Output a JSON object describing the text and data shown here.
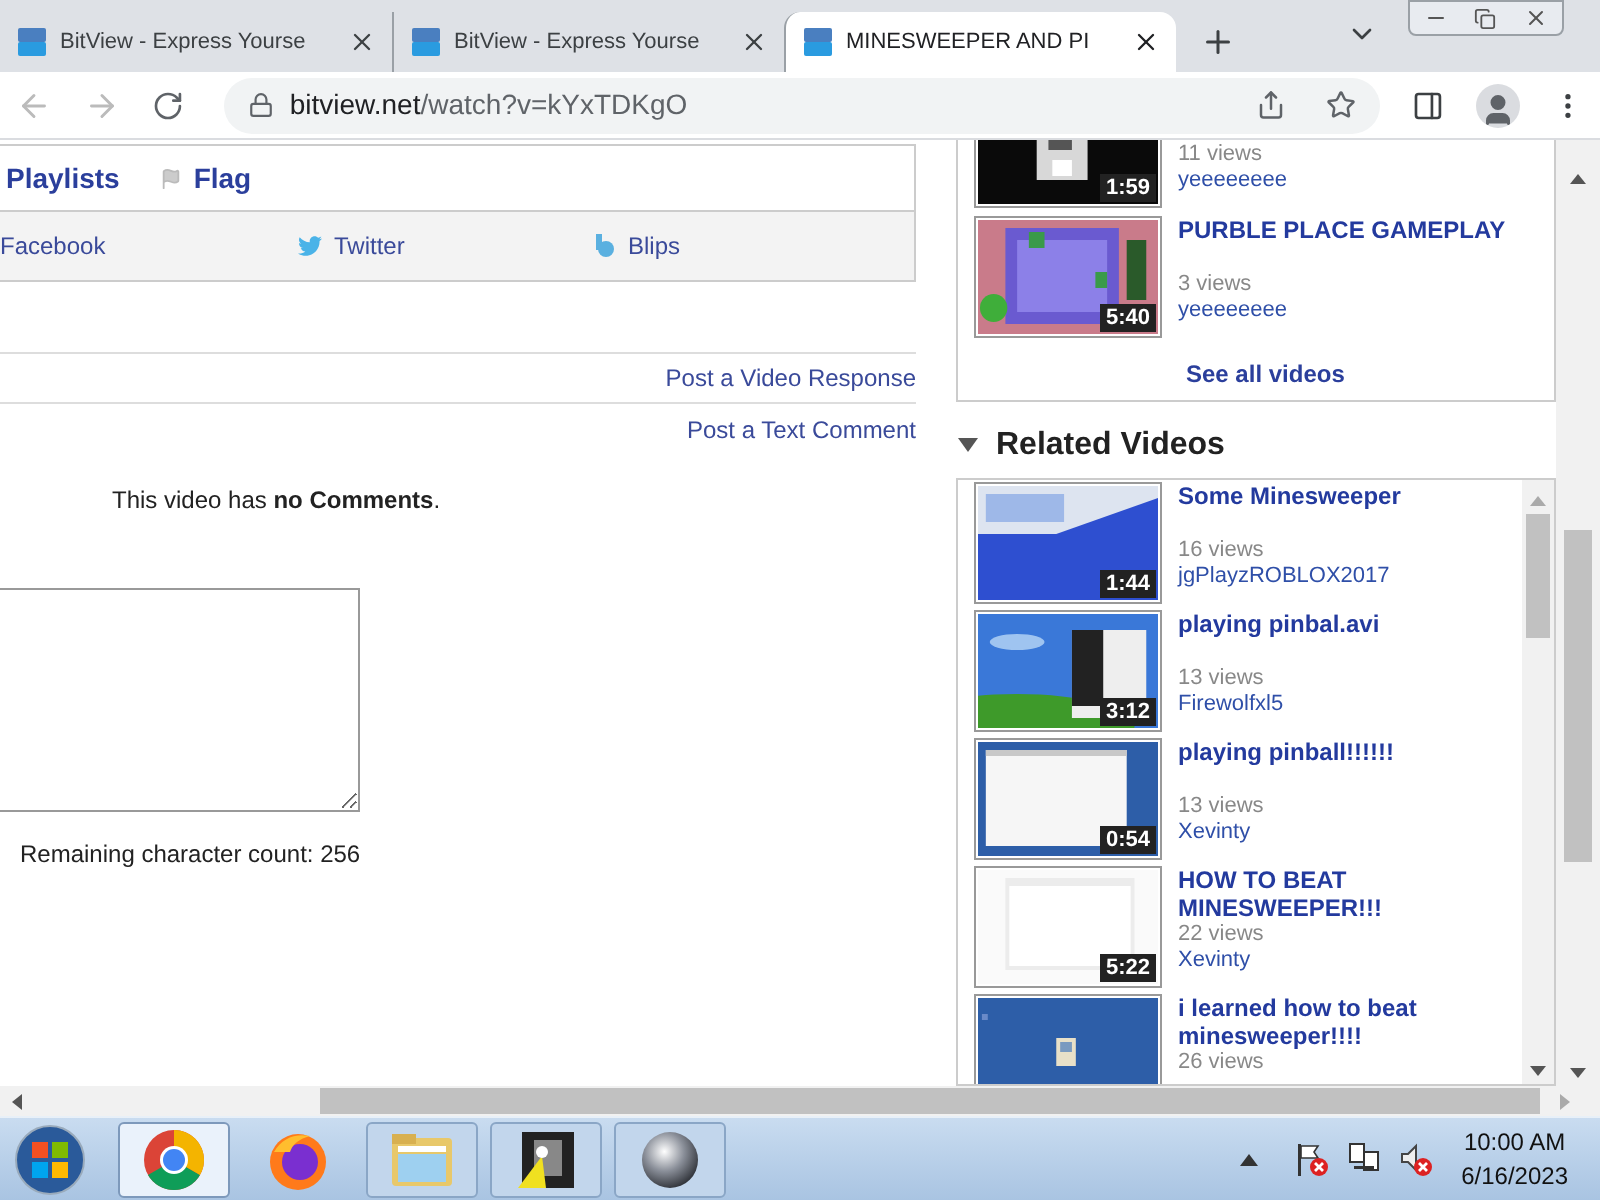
{
  "browser": {
    "tabs": [
      {
        "title": "BitView - Express Yourse",
        "selected": false
      },
      {
        "title": "BitView - Express Yourse",
        "selected": false
      },
      {
        "title": "MINESWEEPER AND PI",
        "selected": true
      }
    ],
    "address": {
      "host": "bitview.net",
      "path": "/watch?v=kYxTDKgO"
    }
  },
  "actions": {
    "links": [
      {
        "kind": "playlists",
        "label": "Playlists"
      },
      {
        "kind": "flag",
        "label": "Flag"
      }
    ],
    "share": [
      {
        "kind": "facebook",
        "label": "Facebook"
      },
      {
        "kind": "twitter",
        "label": "Twitter"
      },
      {
        "kind": "blips",
        "label": "Blips"
      }
    ]
  },
  "comments": {
    "post_links": [
      "Post a Video Response",
      "Post a Text Comment"
    ],
    "empty_message": "This video has **no Comments**.",
    "counter": "Remaining character count: 256"
  },
  "more_videos": {
    "items": [
      {
        "views": "11 views",
        "author": "yeeeeeeee",
        "duration": "1:59"
      },
      {
        "title": "PURBLE PLACE GAMEPLAY",
        "views": "3 views",
        "author": "yeeeeeeee",
        "duration": "5:40"
      }
    ],
    "see_all": "See all videos"
  },
  "related": {
    "heading": "Related Videos",
    "expanded": true,
    "items": [
      {
        "title": "Some Minesweeper",
        "views": "16 views",
        "author": "jgPlayzROBLOX2017",
        "duration": "1:44"
      },
      {
        "title": "playing pinbal.avi",
        "views": "13 views",
        "author": "Firewolfxl5",
        "duration": "3:12"
      },
      {
        "title": "playing pinball!!!!!!",
        "views": "13 views",
        "author": "Xevinty",
        "duration": "0:54"
      },
      {
        "title": "HOW TO BEAT MINESWEEPER!!!",
        "views": "22 views",
        "author": "Xevinty",
        "duration": "5:22"
      },
      {
        "title": "i learned how to beat minesweeper!!!!",
        "views": "26 views"
      }
    ]
  },
  "taskbar": {
    "apps": [
      {
        "kind": "chrome",
        "selected": true
      },
      {
        "kind": "firefox",
        "selected": false
      },
      {
        "kind": "explorer",
        "selected": false
      },
      {
        "kind": "tool",
        "selected": false
      },
      {
        "kind": "sphere",
        "selected": false
      }
    ],
    "time": "10:00 AM",
    "date": "6/16/2023"
  }
}
